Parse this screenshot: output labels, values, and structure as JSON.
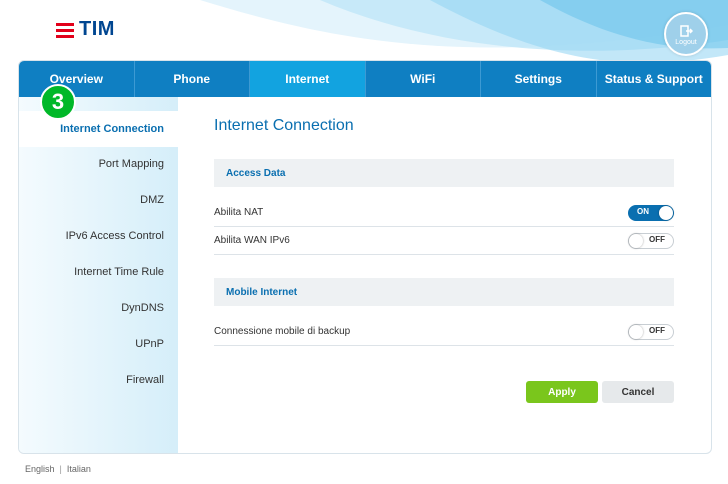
{
  "brand": {
    "logo_text": "TIM",
    "logo_color": "#004691",
    "mark_color": "#e2001a"
  },
  "header": {
    "logout_label": "Logout",
    "logout_icon": "logout-door-icon"
  },
  "nav": {
    "tabs": [
      {
        "label": "Overview",
        "active": false
      },
      {
        "label": "Phone",
        "active": false
      },
      {
        "label": "Internet",
        "active": true
      },
      {
        "label": "WiFi",
        "active": false
      },
      {
        "label": "Settings",
        "active": false
      },
      {
        "label": "Status & Support",
        "active": false
      }
    ],
    "tab_color": "#0f7fc2",
    "active_tab_color": "#12a3e0"
  },
  "sidebar": {
    "items": [
      {
        "label": "Internet Connection",
        "active": true
      },
      {
        "label": "Port Mapping",
        "active": false
      },
      {
        "label": "DMZ",
        "active": false
      },
      {
        "label": "IPv6 Access Control",
        "active": false
      },
      {
        "label": "Internet Time Rule",
        "active": false
      },
      {
        "label": "DynDNS",
        "active": false
      },
      {
        "label": "UPnP",
        "active": false
      },
      {
        "label": "Firewall",
        "active": false
      }
    ]
  },
  "step_badge": {
    "number": "3",
    "color": "#00b828"
  },
  "main": {
    "title": "Internet Connection",
    "sections": [
      {
        "heading": "Access Data",
        "rows": [
          {
            "label": "Abilita NAT",
            "state": "ON",
            "on": true
          },
          {
            "label": "Abilita WAN IPv6",
            "state": "OFF",
            "on": false
          }
        ]
      },
      {
        "heading": "Mobile Internet",
        "rows": [
          {
            "label": "Connessione mobile di backup",
            "state": "OFF",
            "on": false
          }
        ]
      }
    ],
    "apply_label": "Apply",
    "cancel_label": "Cancel",
    "apply_color": "#7ac61c"
  },
  "footer": {
    "lang_english": "English",
    "lang_italian": "Italian"
  }
}
